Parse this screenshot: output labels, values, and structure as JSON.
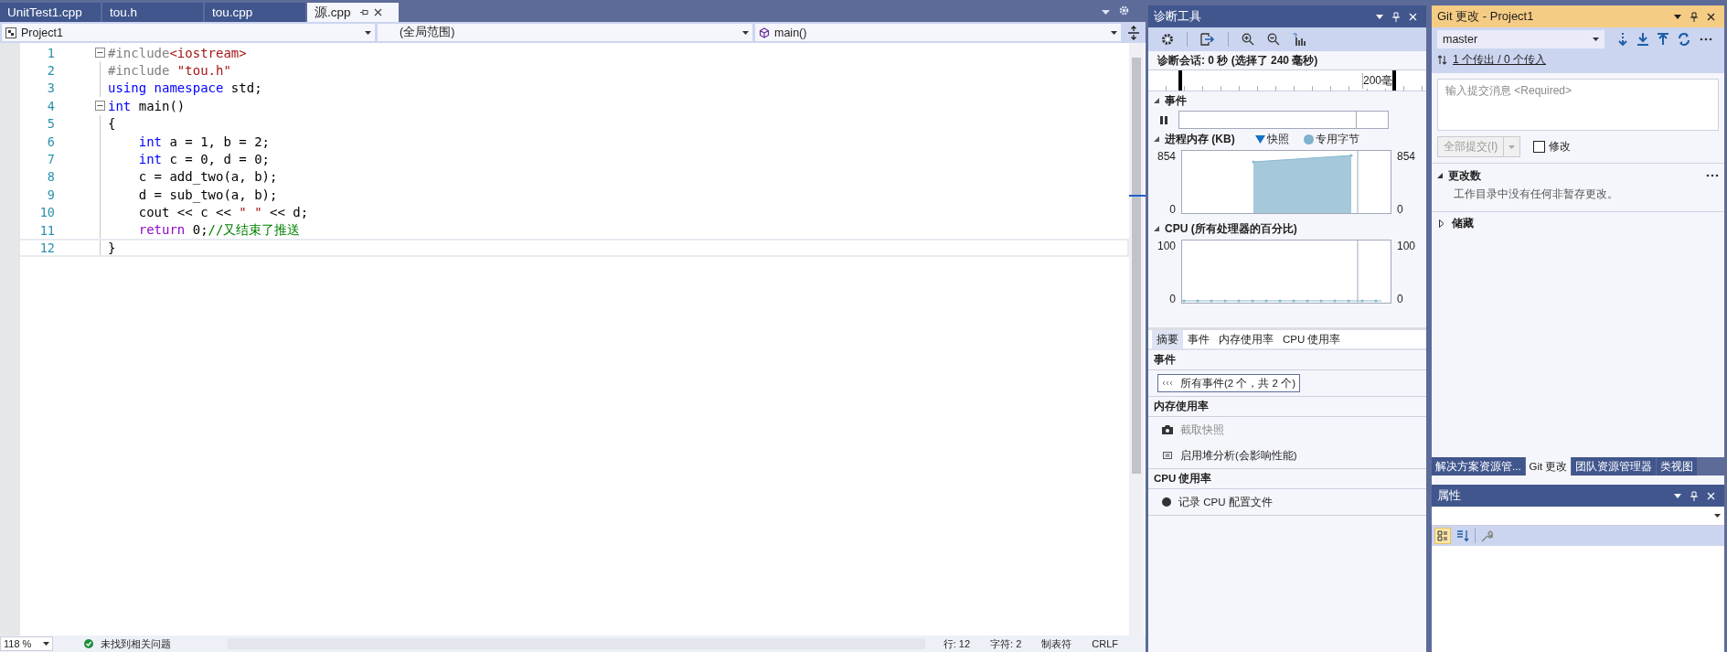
{
  "editor": {
    "tabs": [
      {
        "label": "UnitTest1.cpp",
        "selected": false
      },
      {
        "label": "tou.h",
        "selected": false
      },
      {
        "label": "tou.cpp",
        "selected": false
      },
      {
        "label": "源.cpp",
        "selected": true
      }
    ],
    "nav": {
      "project": "Project1",
      "scope": "(全局范围)",
      "member": "main()"
    },
    "lines": [
      {
        "number": "1",
        "fold": true,
        "tokens": [
          {
            "text": "#include",
            "kind": "preproc"
          },
          {
            "text": "<iostream>",
            "kind": "string"
          }
        ]
      },
      {
        "number": "2",
        "fold": false,
        "tokens": [
          {
            "text": "#include ",
            "kind": "preproc"
          },
          {
            "text": "\"tou.h\"",
            "kind": "string"
          }
        ]
      },
      {
        "number": "3",
        "fold": false,
        "tokens": [
          {
            "text": "using namespace",
            "kind": "keyword"
          },
          {
            "text": " std;",
            "kind": "plain"
          }
        ]
      },
      {
        "number": "4",
        "fold": true,
        "tokens": [
          {
            "text": "int",
            "kind": "keyword"
          },
          {
            "text": " main()",
            "kind": "plain"
          }
        ]
      },
      {
        "number": "5",
        "fold": false,
        "tokens": [
          {
            "text": "{",
            "kind": "plain"
          }
        ]
      },
      {
        "number": "6",
        "fold": false,
        "tokens": [
          {
            "text": "    int",
            "kind": "keyword"
          },
          {
            "text": " a = 1, b = 2;",
            "kind": "plain"
          }
        ]
      },
      {
        "number": "7",
        "fold": false,
        "tokens": [
          {
            "text": "    int",
            "kind": "keyword"
          },
          {
            "text": " c = 0, d = 0;",
            "kind": "plain"
          }
        ]
      },
      {
        "number": "8",
        "fold": false,
        "tokens": [
          {
            "text": "    c = add_two(a, b);",
            "kind": "plain"
          }
        ]
      },
      {
        "number": "9",
        "fold": false,
        "tokens": [
          {
            "text": "    d = sub_two(a, b);",
            "kind": "plain"
          }
        ]
      },
      {
        "number": "10",
        "fold": false,
        "tokens": [
          {
            "text": "    cout << c << ",
            "kind": "plain"
          },
          {
            "text": "\" \"",
            "kind": "string"
          },
          {
            "text": " << d;",
            "kind": "plain"
          }
        ]
      },
      {
        "number": "11",
        "fold": false,
        "tokens": [
          {
            "text": "    return",
            "kind": "control"
          },
          {
            "text": " 0;",
            "kind": "plain"
          },
          {
            "text": "//又结束了推送",
            "kind": "comment"
          }
        ]
      },
      {
        "number": "12",
        "fold": false,
        "tokens": [
          {
            "text": "}",
            "kind": "plain"
          }
        ]
      }
    ],
    "status": {
      "zoom": "118 %",
      "issues": "未找到相关问题",
      "line": "行: 12",
      "column": "字符: 2",
      "indent": "制表符",
      "eol": "CRLF"
    }
  },
  "diagnostics": {
    "title": "诊断工具",
    "active": false,
    "session": "诊断会话: 0 秒 (选择了 240 毫秒)",
    "ruler_label": "200毫",
    "events_header": "事件",
    "memory_header": "进程内存 (KB)",
    "legend": [
      {
        "label": "快照",
        "kind": "triangle"
      },
      {
        "label": "专用字节",
        "kind": "circle"
      }
    ],
    "memory_axis": {
      "left_max": "854",
      "left_min": "0",
      "right_max": "854",
      "right_min": "0"
    },
    "cpu_header": "CPU (所有处理器的百分比)",
    "cpu_axis": {
      "left_max": "100",
      "left_min": "0",
      "right_max": "100",
      "right_min": "0"
    },
    "tabs": [
      {
        "label": "摘要",
        "selected": true
      },
      {
        "label": "事件",
        "selected": false
      },
      {
        "label": "内存使用率",
        "selected": false
      },
      {
        "label": "CPU 使用率",
        "selected": false
      }
    ],
    "sections": [
      {
        "title": "事件",
        "items": [
          {
            "label": "所有事件(2 个，共 2 个)",
            "kind": "events",
            "disabled": false,
            "focused": true
          }
        ]
      },
      {
        "title": "内存使用率",
        "items": [
          {
            "label": "截取快照",
            "kind": "camera",
            "disabled": true,
            "focused": false
          },
          {
            "label": "启用堆分析(会影响性能)",
            "kind": "chip",
            "disabled": false,
            "focused": false
          }
        ]
      },
      {
        "title": "CPU 使用率",
        "items": [
          {
            "label": "记录 CPU 配置文件",
            "kind": "dot",
            "disabled": false,
            "focused": false
          }
        ]
      }
    ]
  },
  "git": {
    "title": "Git 更改 - Project1",
    "active": true,
    "branch": "master",
    "sync": "1 个传出 / 0 个传入",
    "message_placeholder": "输入提交消息 <Required>",
    "commit_button": "全部提交(I)",
    "amend": {
      "label": "修改",
      "checked": false
    },
    "changes_header": "更改数",
    "changes_empty": "工作目录中没有任何非暂存更改。",
    "stash_header": "储藏",
    "bottom_tabs": [
      {
        "label": "解决方案资源管...",
        "selected": false
      },
      {
        "label": "Git 更改",
        "selected": true
      },
      {
        "label": "团队资源管理器",
        "selected": false
      },
      {
        "label": "类视图",
        "selected": false
      }
    ]
  },
  "properties": {
    "title": "属性"
  }
}
